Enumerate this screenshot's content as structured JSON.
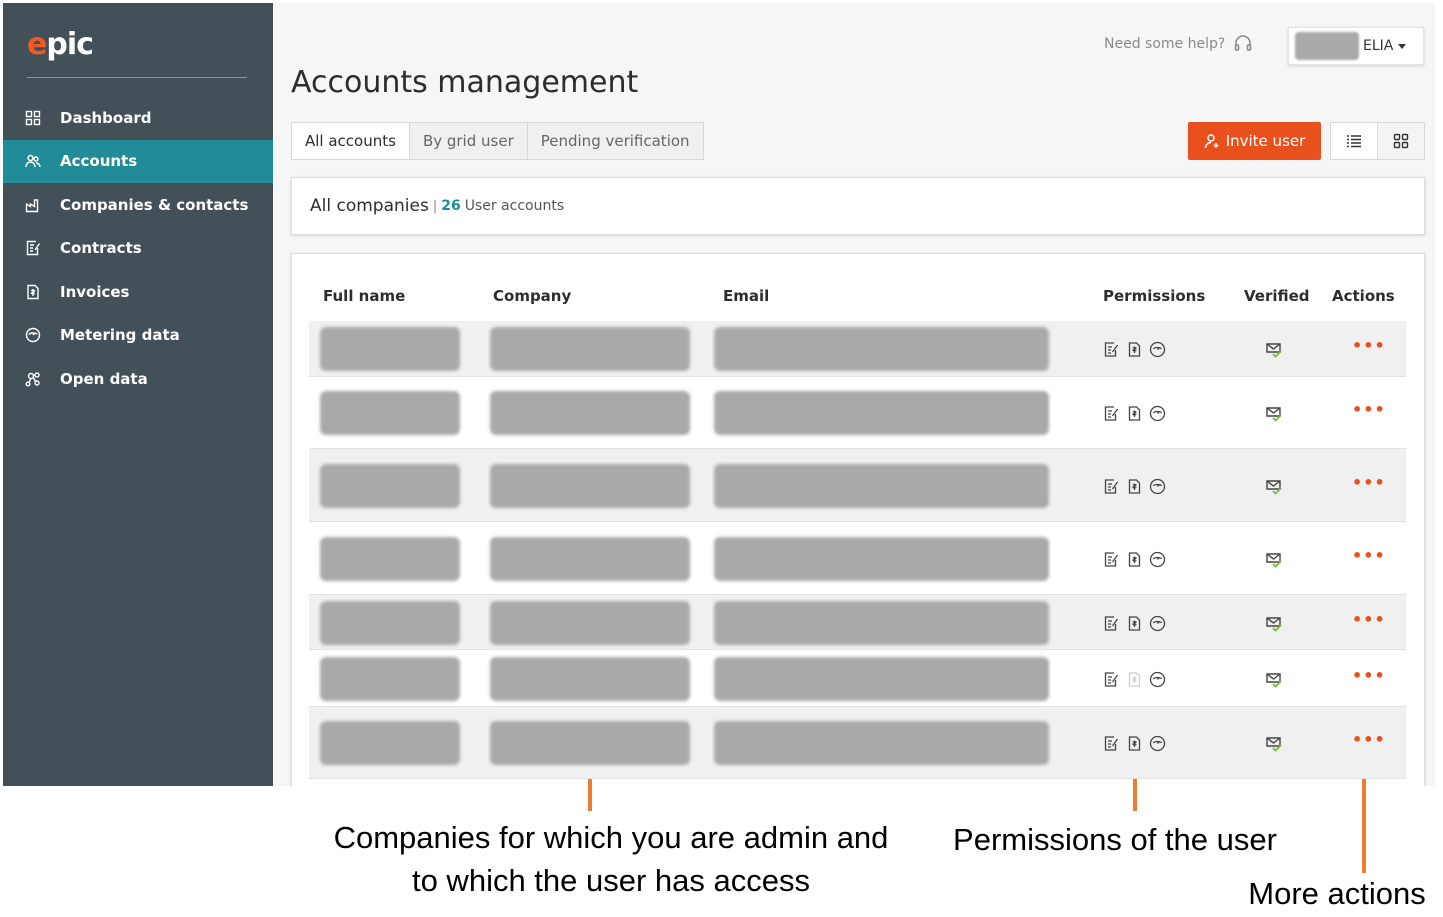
{
  "sidebar": {
    "logo": {
      "part1": "e",
      "part2": "pic",
      "accent_color": "#f15a24"
    },
    "items": [
      {
        "label": "Dashboard",
        "icon": "dashboard-grid-icon",
        "active": false
      },
      {
        "label": "Accounts",
        "icon": "users-icon",
        "active": true
      },
      {
        "label": "Companies & contacts",
        "icon": "factory-icon",
        "active": false
      },
      {
        "label": "Contracts",
        "icon": "contract-edit-icon",
        "active": false
      },
      {
        "label": "Invoices",
        "icon": "invoice-icon",
        "active": false
      },
      {
        "label": "Metering data",
        "icon": "meter-gauge-icon",
        "active": false
      },
      {
        "label": "Open data",
        "icon": "open-data-icon",
        "active": false
      }
    ]
  },
  "header": {
    "help_text": "Need some help?",
    "user_name": "ELIA"
  },
  "page": {
    "title": "Accounts management",
    "tabs": [
      {
        "label": "All accounts",
        "active": true
      },
      {
        "label": "By grid user",
        "active": false
      },
      {
        "label": "Pending verification",
        "active": false
      }
    ],
    "invite_label": "Invite user"
  },
  "companies_bar": {
    "title": "All companies",
    "separator": "|",
    "count": "26",
    "label": "User accounts"
  },
  "table": {
    "columns": [
      "Full name",
      "Company",
      "Email",
      "Permissions",
      "Verified",
      "Actions"
    ],
    "rows": [
      {
        "invoice_permission": true
      },
      {
        "invoice_permission": true
      },
      {
        "invoice_permission": true
      },
      {
        "invoice_permission": true
      },
      {
        "invoice_permission": true
      },
      {
        "invoice_permission": false
      },
      {
        "invoice_permission": true
      }
    ],
    "actions_glyph": "•••"
  },
  "annotations": {
    "companies": "Companies for which you are admin and to which the user has access",
    "permissions": "Permissions of the user",
    "actions": "More actions",
    "color": "#ed7d31"
  },
  "colors": {
    "sidebar_bg": "#435058",
    "active_nav": "#218c98",
    "accent_orange": "#e8501e",
    "verified_check": "#7ab648"
  }
}
